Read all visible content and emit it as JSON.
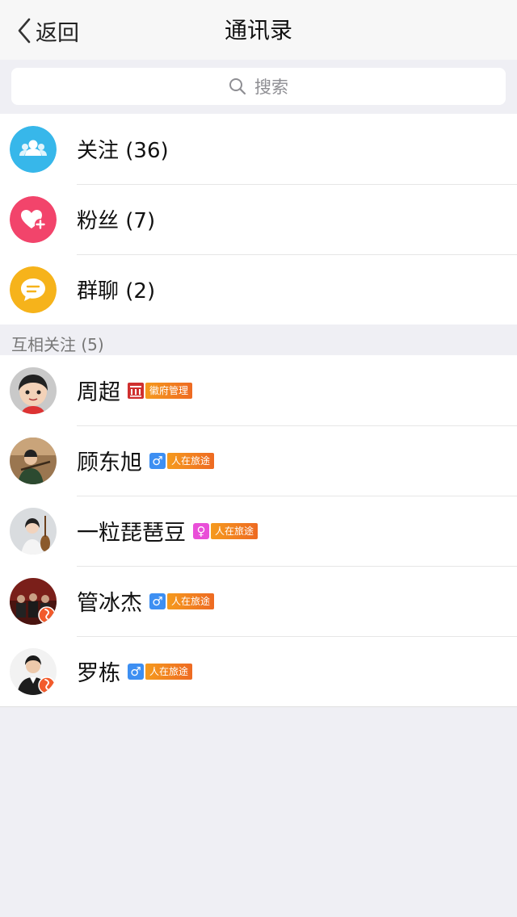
{
  "nav": {
    "back_label": "返回",
    "title": "通讯录"
  },
  "search": {
    "placeholder": "搜索"
  },
  "menu": [
    {
      "label": "关注 (36)",
      "icon": "group-icon",
      "color": "#37b7ea"
    },
    {
      "label": "粉丝 (7)",
      "icon": "heart-plus-icon",
      "color": "#f2446b"
    },
    {
      "label": "群聊 (2)",
      "icon": "chat-bubble-icon",
      "color": "#f6b31b"
    }
  ],
  "section": {
    "title": "互相关注 (5)"
  },
  "contacts": [
    {
      "name": "周超",
      "badge": "徽府管理",
      "tag_icon": "government-icon"
    },
    {
      "name": "顾东旭",
      "badge": "人在旅途",
      "gender": "♂",
      "gender_color": "#3d8ff2"
    },
    {
      "name": "一粒琵琶豆",
      "badge": "人在旅途",
      "gender": "♀",
      "gender_color": "#e94fd8"
    },
    {
      "name": "管冰杰",
      "badge": "人在旅途",
      "gender": "♂",
      "gender_color": "#3d8ff2"
    },
    {
      "name": "罗栋",
      "badge": "人在旅途",
      "gender": "♂",
      "gender_color": "#3d8ff2"
    }
  ]
}
